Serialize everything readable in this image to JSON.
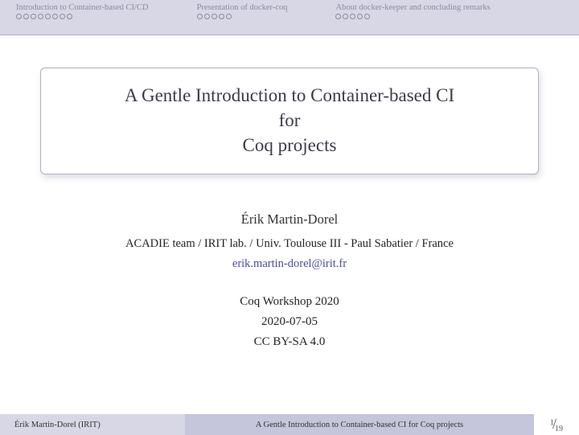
{
  "nav": {
    "sections": [
      {
        "label": "Introduction to Container-based CI/CD",
        "dots": 8
      },
      {
        "label": "Presentation of docker-coq",
        "dots": 5
      },
      {
        "label": "About docker-keeper and concluding remarks",
        "dots": 5
      }
    ]
  },
  "title": {
    "line1": "A Gentle Introduction to Container-based CI",
    "line2": "for",
    "line3": "Coq projects"
  },
  "author": {
    "name": "Érik Martin-Dorel",
    "affiliation": "ACADIE team / IRIT lab. / Univ. Toulouse III - Paul Sabatier / France",
    "email": "erik.martin-dorel@irit.fr"
  },
  "event": {
    "venue": "Coq Workshop 2020",
    "date": "2020-07-05",
    "license": "CC BY-SA 4.0"
  },
  "footer": {
    "author_short": "Érik Martin-Dorel  (IRIT)",
    "title_short": "A Gentle Introduction to Container-based CI for Coq projects",
    "page_current": "1",
    "page_total": "19"
  }
}
